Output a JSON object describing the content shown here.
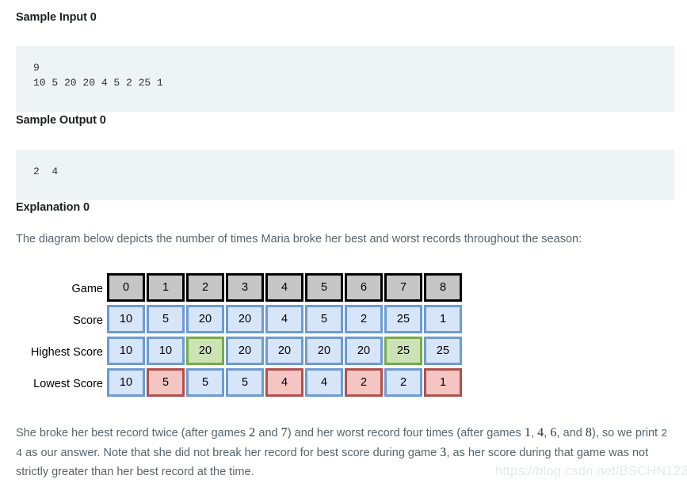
{
  "sections": {
    "sample_input_heading": "Sample Input 0",
    "sample_output_heading": "Sample Output 0",
    "explanation_heading": "Explanation 0"
  },
  "code": {
    "input": "9\n10 5 20 20 4 5 2 25 1",
    "output": "2  4"
  },
  "explanation": {
    "intro": "The diagram below depicts the number of times Maria broke her best and worst records throughout the season:",
    "outro_part1": "She broke her best record twice (after games ",
    "outro_num1": "2",
    "outro_part2": " and ",
    "outro_num2": "7",
    "outro_part3": ") and her worst record four times (after games ",
    "outro_num3": "1",
    "outro_part4": ", ",
    "outro_num4": "4",
    "outro_part5": ", ",
    "outro_num5": "6",
    "outro_part6": ", and ",
    "outro_num6": "8",
    "outro_part7": "), so we print ",
    "outro_answer": "2  4",
    "outro_part8": " as our answer. Note that she did not break her record for best score during game ",
    "outro_num7": "3",
    "outro_part9": ", as her score during that game was not strictly greater than her best record at the time."
  },
  "diagram": {
    "rows": [
      {
        "label": "Game",
        "style": "game",
        "values": [
          "0",
          "1",
          "2",
          "3",
          "4",
          "5",
          "6",
          "7",
          "8"
        ],
        "highlights": [
          "game",
          "game",
          "game",
          "game",
          "game",
          "game",
          "game",
          "game",
          "game"
        ]
      },
      {
        "label": "Score",
        "style": "blue",
        "values": [
          "10",
          "5",
          "20",
          "20",
          "4",
          "5",
          "2",
          "25",
          "1"
        ],
        "highlights": [
          "blue",
          "blue",
          "blue",
          "blue",
          "blue",
          "blue",
          "blue",
          "blue",
          "blue"
        ]
      },
      {
        "label": "Highest Score",
        "style": "blue",
        "values": [
          "10",
          "10",
          "20",
          "20",
          "20",
          "20",
          "20",
          "25",
          "25"
        ],
        "highlights": [
          "blue",
          "blue",
          "green",
          "blue",
          "blue",
          "blue",
          "blue",
          "green",
          "blue"
        ]
      },
      {
        "label": "Lowest Score",
        "style": "blue",
        "values": [
          "10",
          "5",
          "5",
          "5",
          "4",
          "4",
          "2",
          "2",
          "1"
        ],
        "highlights": [
          "blue",
          "red",
          "blue",
          "blue",
          "red",
          "blue",
          "red",
          "blue",
          "red"
        ]
      }
    ],
    "colors": {
      "game_fill": "#c6c6c6",
      "game_border": "#000000",
      "blue_fill": "#d7e5f8",
      "blue_border": "#6e9bd1",
      "green_fill": "#cbe3b5",
      "green_border": "#76ab4c",
      "red_fill": "#f5c5c3",
      "red_border": "#b0504d"
    }
  },
  "watermark": {
    "text": "https://blog.csdn.net/BSCHN123"
  }
}
